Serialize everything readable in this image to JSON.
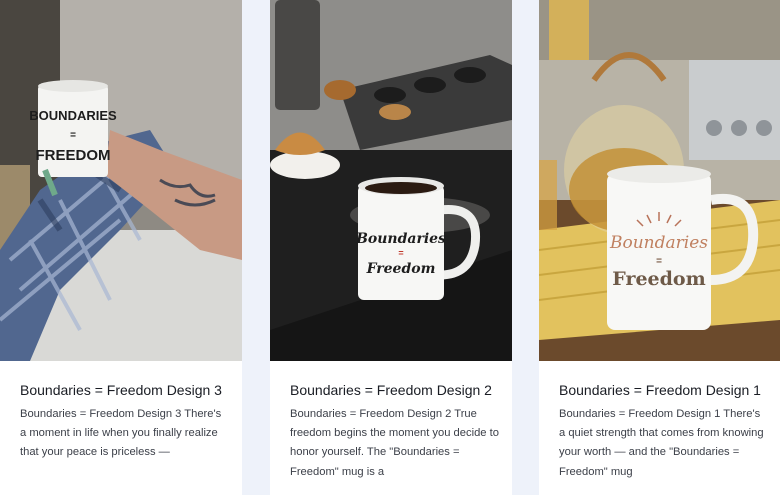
{
  "posts": [
    {
      "title": "Boundaries = Freedom Design 3",
      "excerpt": "Boundaries = Freedom Design 3 There's a moment in life when you finally realize that your peace is priceless —",
      "image_icon": "mug-lifestyle-photo",
      "mug_text": [
        "BOUNDARIES",
        "=",
        "FREEDOM"
      ]
    },
    {
      "title": "Boundaries = Freedom Design 2",
      "excerpt": "Boundaries = Freedom Design 2 True freedom begins the moment you decide to honor yourself. The \"Boundaries = Freedom\" mug is a",
      "image_icon": "mug-kitchen-photo",
      "mug_text": [
        "Boundaries",
        "=",
        "Freedom"
      ]
    },
    {
      "title": "Boundaries = Freedom Design 1",
      "excerpt": "Boundaries = Freedom Design 1 There's a quiet strength that comes from knowing your worth — and the \"Boundaries = Freedom\" mug",
      "image_icon": "mug-teapot-photo",
      "mug_text": [
        "Boundaries",
        "=",
        "Freedom"
      ]
    }
  ]
}
